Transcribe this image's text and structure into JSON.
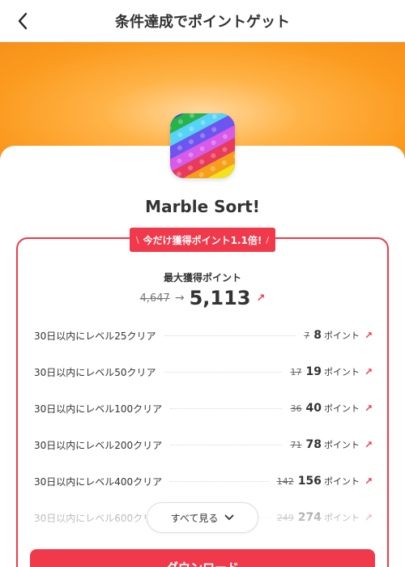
{
  "header": {
    "title": "条件達成でポイントゲット",
    "back_icon": "chevron-left-icon"
  },
  "app": {
    "name": "Marble Sort!",
    "icon": "marble-sort-app-icon"
  },
  "promo": {
    "left_mark": "\\",
    "text": "今だけ獲得ポイント1.1倍!",
    "right_mark": "/"
  },
  "summary": {
    "label": "最大獲得ポイント",
    "old_total": "4,647",
    "new_total": "5,113"
  },
  "tasks": [
    {
      "label": "30日以内にレベル25クリア",
      "old": "7",
      "new": "8",
      "unit": "ポイント"
    },
    {
      "label": "30日以内にレベル50クリア",
      "old": "17",
      "new": "19",
      "unit": "ポイント"
    },
    {
      "label": "30日以内にレベル100クリア",
      "old": "36",
      "new": "40",
      "unit": "ポイント"
    },
    {
      "label": "30日以内にレベル200クリア",
      "old": "71",
      "new": "78",
      "unit": "ポイント"
    },
    {
      "label": "30日以内にレベル400クリア",
      "old": "142",
      "new": "156",
      "unit": "ポイント"
    },
    {
      "label": "30日以内にレベル600クリア",
      "old": "249",
      "new": "274",
      "unit": "ポイント"
    }
  ],
  "see_all": {
    "label": "すべて見る"
  },
  "download": {
    "label": "ダウンロード"
  },
  "colors": {
    "accent": "#f0394b",
    "hero_orange": "#fb9a1e"
  }
}
